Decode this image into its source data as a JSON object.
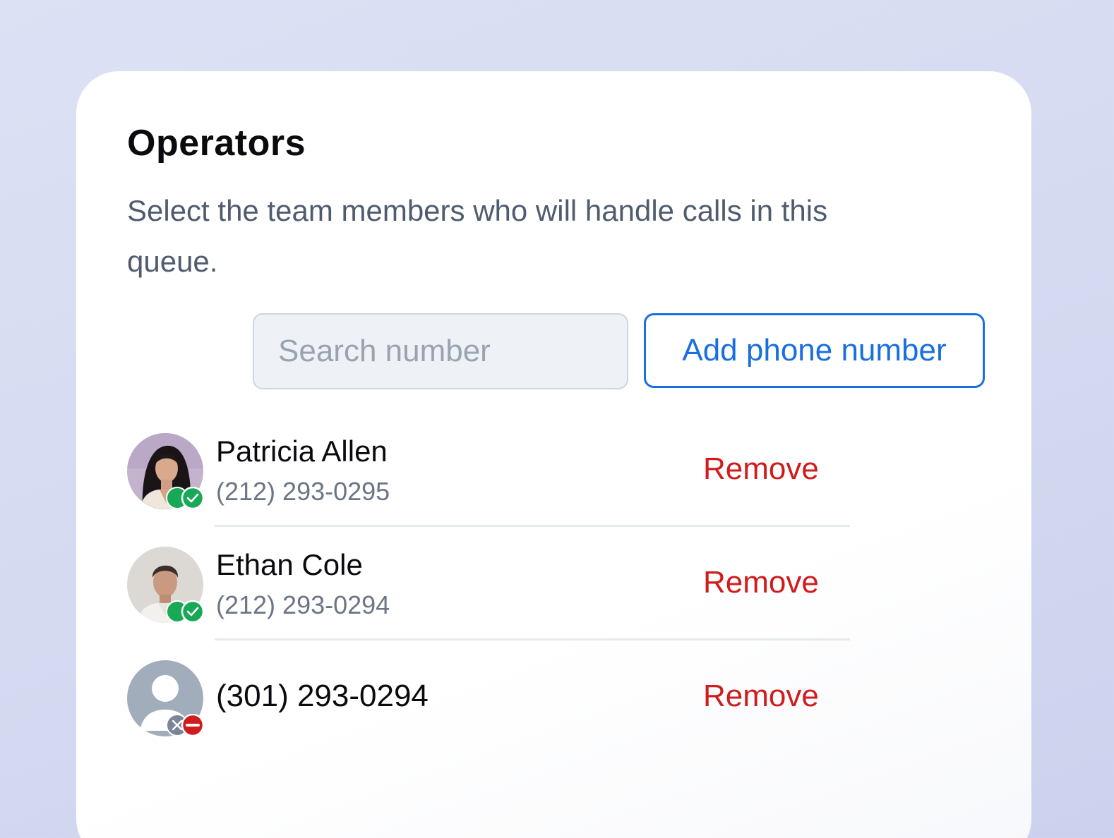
{
  "panel": {
    "title": "Operators",
    "description": "Select the team members who will handle calls in this queue."
  },
  "search": {
    "placeholder": "Search number",
    "value": "",
    "dropdown_icon": "chevron-down-icon"
  },
  "add_button": {
    "label": "Add phone number"
  },
  "operators": [
    {
      "name": "Patricia Allen",
      "phone": "(212) 293-0295",
      "status": "available",
      "status_icon": "check-circle-icon",
      "remove_label": "Remove"
    },
    {
      "name": "Ethan Cole",
      "phone": "(212) 293-0294",
      "status": "available",
      "status_icon": "check-circle-icon",
      "remove_label": "Remove"
    },
    {
      "name": "",
      "phone": "(301) 293-0294",
      "status": "unavailable",
      "status_icon": "do-not-disturb-icon",
      "remove_label": "Remove"
    }
  ],
  "colors": {
    "accent": "#1a6fe0",
    "danger": "#d01c1c",
    "available": "#18a957",
    "muted": "#6b7585"
  }
}
